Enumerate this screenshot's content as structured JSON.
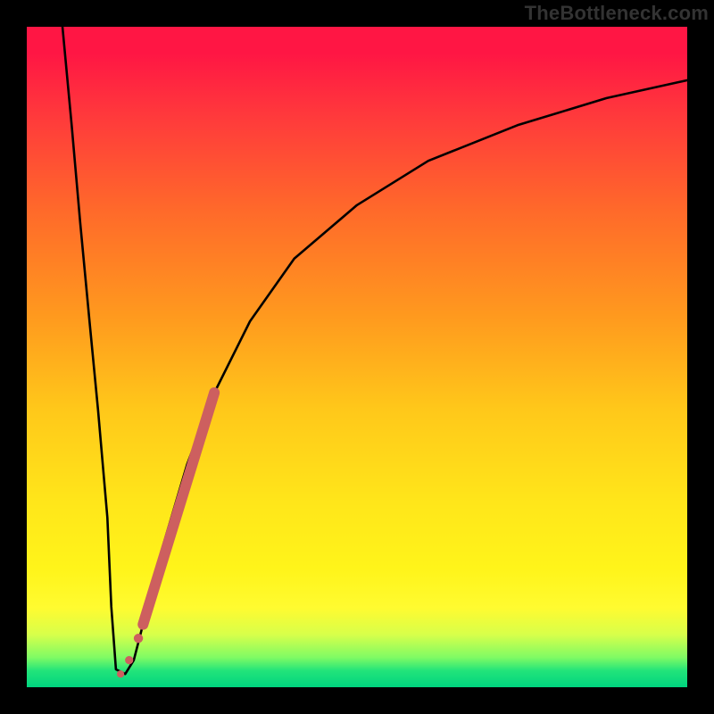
{
  "watermark": "TheBottleneck.com",
  "chart_data": {
    "type": "line",
    "title": "",
    "xlabel": "",
    "ylabel": "",
    "xlim": [
      0,
      100
    ],
    "ylim": [
      0,
      100
    ],
    "gradient_stops": [
      {
        "pos": 0,
        "color": "#ff1644"
      },
      {
        "pos": 4,
        "color": "#ff1644"
      },
      {
        "pos": 14,
        "color": "#ff3b3b"
      },
      {
        "pos": 28,
        "color": "#ff6a2a"
      },
      {
        "pos": 44,
        "color": "#ff9a1e"
      },
      {
        "pos": 58,
        "color": "#ffc81a"
      },
      {
        "pos": 72,
        "color": "#ffe61a"
      },
      {
        "pos": 82,
        "color": "#fff41a"
      },
      {
        "pos": 88,
        "color": "#fffb30"
      },
      {
        "pos": 92,
        "color": "#d8ff4a"
      },
      {
        "pos": 95.5,
        "color": "#7ffb64"
      },
      {
        "pos": 97.5,
        "color": "#22e47a"
      },
      {
        "pos": 100,
        "color": "#00d47f"
      }
    ],
    "series": [
      {
        "name": "bottleneck-curve",
        "x": [
          5.4,
          6.8,
          8.1,
          9.5,
          10.8,
          12.2,
          12.8,
          13.5,
          14.9,
          16.2,
          17.6,
          20.3,
          24.3,
          28.4,
          33.8,
          40.5,
          50.0,
          60.8,
          74.3,
          87.8,
          100.0
        ],
        "y": [
          100.0,
          85.1,
          70.3,
          55.4,
          41.9,
          25.7,
          12.2,
          2.7,
          2.0,
          4.1,
          9.5,
          20.3,
          33.8,
          44.6,
          55.4,
          64.9,
          73.0,
          79.7,
          85.1,
          89.2,
          91.9
        ]
      }
    ],
    "annotations": [
      {
        "name": "highlight-stroke",
        "type": "line",
        "color": "#cd5f5f",
        "width": 12,
        "points": [
          {
            "x": 17.6,
            "y": 9.5
          },
          {
            "x": 28.4,
            "y": 44.6
          }
        ]
      },
      {
        "name": "highlight-dot-1",
        "type": "dot",
        "color": "#cd5f5f",
        "r": 5.2,
        "x": 16.9,
        "y": 7.4
      },
      {
        "name": "highlight-dot-2",
        "type": "dot",
        "color": "#cd5f5f",
        "r": 4.6,
        "x": 15.5,
        "y": 4.1
      },
      {
        "name": "highlight-dot-3",
        "type": "dot",
        "color": "#cd5f5f",
        "r": 4.1,
        "x": 14.2,
        "y": 2.0
      }
    ]
  }
}
